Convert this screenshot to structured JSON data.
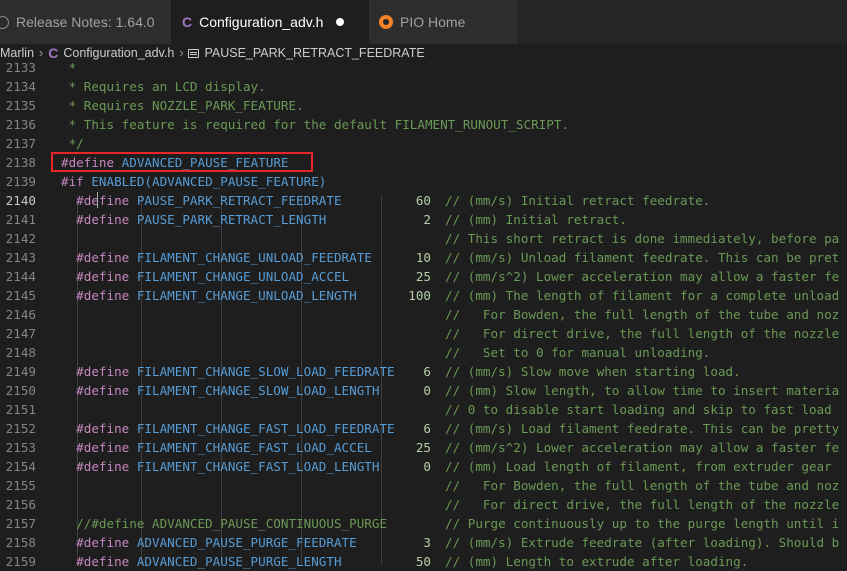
{
  "tabs": [
    {
      "label": "Release Notes: 1.64.0",
      "icon": "info-icon"
    },
    {
      "label": "Configuration_adv.h",
      "icon": "c-file-icon",
      "modified": true
    },
    {
      "label": "PIO Home",
      "icon": "platformio-icon"
    }
  ],
  "breadcrumb": {
    "root": "Marlin",
    "file": "Configuration_adv.h",
    "symbol": "PAUSE_PARK_RETRACT_FEEDRATE"
  },
  "lines": [
    {
      "n": "2133",
      "text": " *"
    },
    {
      "n": "2134",
      "text": " * Requires an LCD display."
    },
    {
      "n": "2135",
      "text": " * Requires NOZZLE_PARK_FEATURE."
    },
    {
      "n": "2136",
      "text": " * This feature is required for the default FILAMENT_RUNOUT_SCRIPT."
    },
    {
      "n": "2137",
      "text": " */"
    },
    {
      "n": "2138",
      "pp": "#define ",
      "mac": "ADVANCED_PAUSE_FEATURE"
    },
    {
      "n": "2139",
      "pp": "#if ",
      "mac": "ENABLED(ADVANCED_PAUSE_FEATURE)"
    },
    {
      "n": "2140",
      "pp": "  #define ",
      "mac": "PAUSE_PARK_RETRACT_FEEDRATE",
      "val": "60",
      "cm": "// (mm/s) Initial retract feedrate."
    },
    {
      "n": "2141",
      "pp": "  #define ",
      "mac": "PAUSE_PARK_RETRACT_LENGTH",
      "val": "2",
      "cm": "// (mm) Initial retract."
    },
    {
      "n": "2142",
      "cm": "// This short retract is done immediately, before pa"
    },
    {
      "n": "2143",
      "pp": "  #define ",
      "mac": "FILAMENT_CHANGE_UNLOAD_FEEDRATE",
      "val": "10",
      "cm": "// (mm/s) Unload filament feedrate. This can be pret"
    },
    {
      "n": "2144",
      "pp": "  #define ",
      "mac": "FILAMENT_CHANGE_UNLOAD_ACCEL",
      "val": "25",
      "cm": "// (mm/s^2) Lower acceleration may allow a faster fe"
    },
    {
      "n": "2145",
      "pp": "  #define ",
      "mac": "FILAMENT_CHANGE_UNLOAD_LENGTH",
      "val": "100",
      "cm": "// (mm) The length of filament for a complete unload"
    },
    {
      "n": "2146",
      "cm": "//   For Bowden, the full length of the tube and noz"
    },
    {
      "n": "2147",
      "cm": "//   For direct drive, the full length of the nozzle"
    },
    {
      "n": "2148",
      "cm": "//   Set to 0 for manual unloading."
    },
    {
      "n": "2149",
      "pp": "  #define ",
      "mac": "FILAMENT_CHANGE_SLOW_LOAD_FEEDRATE",
      "val": "6",
      "cm": "// (mm/s) Slow move when starting load."
    },
    {
      "n": "2150",
      "pp": "  #define ",
      "mac": "FILAMENT_CHANGE_SLOW_LOAD_LENGTH",
      "val": "0",
      "cm": "// (mm) Slow length, to allow time to insert materia"
    },
    {
      "n": "2151",
      "cm": "// 0 to disable start loading and skip to fast load"
    },
    {
      "n": "2152",
      "pp": "  #define ",
      "mac": "FILAMENT_CHANGE_FAST_LOAD_FEEDRATE",
      "val": "6",
      "cm": "// (mm/s) Load filament feedrate. This can be pretty"
    },
    {
      "n": "2153",
      "pp": "  #define ",
      "mac": "FILAMENT_CHANGE_FAST_LOAD_ACCEL",
      "val": "25",
      "cm": "// (mm/s^2) Lower acceleration may allow a faster fe"
    },
    {
      "n": "2154",
      "pp": "  #define ",
      "mac": "FILAMENT_CHANGE_FAST_LOAD_LENGTH",
      "val": "0",
      "cm": "// (mm) Load length of filament, from extruder gear"
    },
    {
      "n": "2155",
      "cm": "//   For Bowden, the full length of the tube and noz"
    },
    {
      "n": "2156",
      "cm": "//   For direct drive, the full length of the nozzle"
    },
    {
      "n": "2157",
      "cm2": "  //#define ADVANCED_PAUSE_CONTINUOUS_PURGE",
      "cm": "// Purge continuously up to the purge length until i"
    },
    {
      "n": "2158",
      "pp": "  #define ",
      "mac": "ADVANCED_PAUSE_PURGE_FEEDRATE",
      "val": "3",
      "cm": "// (mm/s) Extrude feedrate (after loading). Should b"
    },
    {
      "n": "2159",
      "pp": "  #define ",
      "mac": "ADVANCED_PAUSE_PURGE_LENGTH",
      "val": "50",
      "cm": "// (mm) Length to extrude after loading."
    }
  ]
}
